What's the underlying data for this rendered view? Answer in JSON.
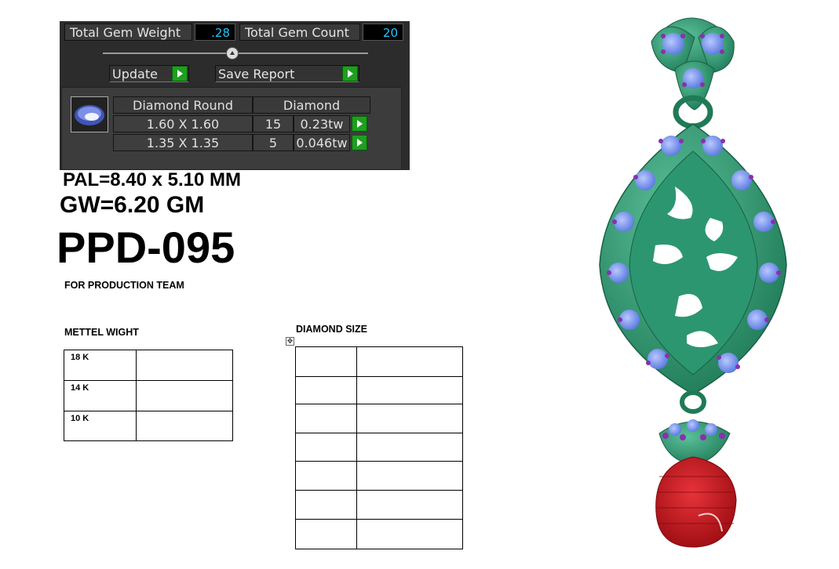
{
  "gem_report": {
    "total_gem_weight_label": "Total Gem Weight",
    "total_gem_weight_value": ".28",
    "total_gem_count_label": "Total Gem Count",
    "total_gem_count_value": "20",
    "update_label": "Update",
    "save_report_label": "Save Report",
    "table": {
      "headers": [
        "Diamond Round",
        "Diamond"
      ],
      "rows": [
        {
          "size": "1.60 X 1.60",
          "count": "15",
          "weight": "0.23tw"
        },
        {
          "size": "1.35 X 1.35",
          "count": "5",
          "weight": "0.046tw"
        }
      ]
    }
  },
  "specs": {
    "pal": "PAL=8.40 x 5.10 MM",
    "gw": "GW=6.20 GM",
    "design_code": "PPD-095",
    "production_note": "FOR PRODUCTION TEAM"
  },
  "metal_weight": {
    "title": "METTEL WIGHT",
    "rows": [
      "18 K",
      "14 K",
      "10 K"
    ]
  },
  "diamond_size": {
    "title": "DIAMOND SIZE"
  },
  "colors": {
    "panel_bg": "#2c2c2c",
    "value_cyan": "#21c6ff",
    "go_green": "#1f9e1f",
    "metal_green": "#2f8f6a",
    "gem_blue": "#7fa0f0",
    "prong_purple": "#8a2fb0",
    "drop_red": "#c4161c"
  },
  "icons": [
    "move-handle-icon",
    "play-arrow-icon",
    "round-gem-icon"
  ]
}
